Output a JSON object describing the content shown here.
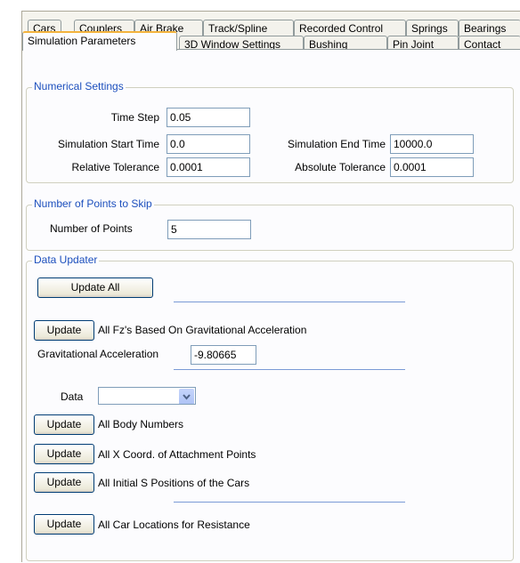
{
  "tabs_row1": [
    "Cars",
    "Couplers",
    "Air Brake",
    "Track/Spline",
    "Recorded Control",
    "Springs",
    "Bearings"
  ],
  "tabs_row2": [
    "Simulation Parameters",
    "3D Window Settings",
    "Bushing",
    "Pin Joint",
    "Contact"
  ],
  "numerical": {
    "legend": "Numerical Settings",
    "time_step_label": "Time Step",
    "time_step": "0.05",
    "start_label": "Simulation Start Time",
    "start": "0.0",
    "end_label": "Simulation End Time",
    "end": "10000.0",
    "rel_tol_label": "Relative Tolerance",
    "rel_tol": "0.0001",
    "abs_tol_label": "Absolute Tolerance",
    "abs_tol": "0.0001"
  },
  "skip": {
    "legend": "Number of Points to Skip",
    "points_label": "Number of Points",
    "points": "5"
  },
  "updater": {
    "legend": "Data Updater",
    "update_all": "Update All",
    "update": "Update",
    "fz_text": "All Fz's Based On Gravitational Acceleration",
    "grav_label": "Gravitational Acceleration",
    "grav_value": "-9.80665",
    "data_label": "Data",
    "data_value": "",
    "body_numbers": "All Body Numbers",
    "x_coord": "All X Coord. of Attachment Points",
    "initial_s": "All Initial S Positions of the Cars",
    "car_locations": "All Car Locations for Resistance"
  },
  "colors": {
    "legend": "#1c4fbd",
    "active_tab": "#f3b33d",
    "separator": "#7a9ad6"
  }
}
